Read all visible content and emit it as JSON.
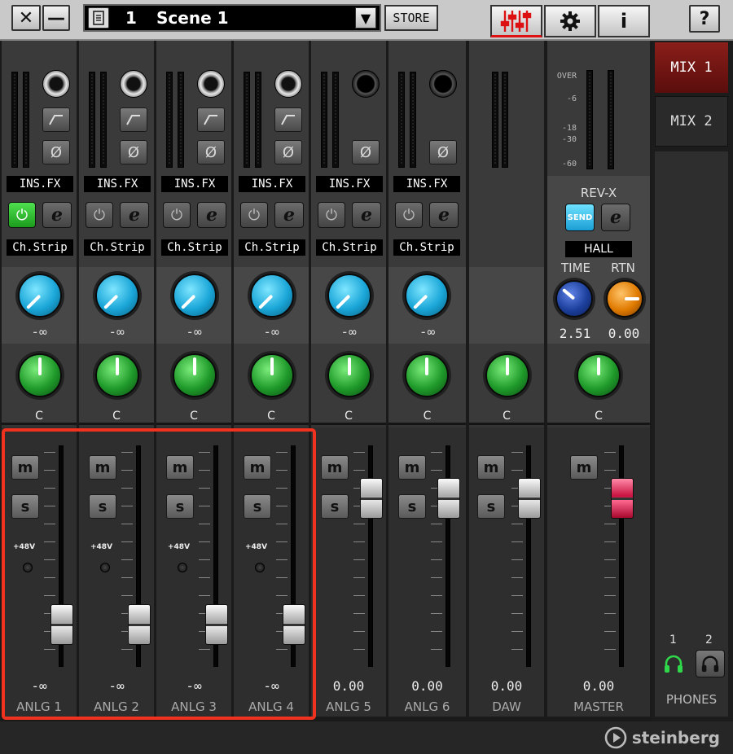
{
  "topbar": {
    "close_label": "✕",
    "minimize_label": "—",
    "scene_number": "1",
    "scene_name": "Scene 1",
    "scene_dropdown": "▼",
    "store_label": "STORE",
    "info_label": "i",
    "help_label": "?"
  },
  "channels": [
    {
      "name": "ANLG 1",
      "ins_fx": "INS.FX",
      "ch_strip": "Ch.Strip",
      "send": "-∞",
      "pan": "C",
      "fader_value": "-∞",
      "phantom": "+48V",
      "jack": "xlr",
      "power_on": true,
      "fader_level": 0.12
    },
    {
      "name": "ANLG 2",
      "ins_fx": "INS.FX",
      "ch_strip": "Ch.Strip",
      "send": "-∞",
      "pan": "C",
      "fader_value": "-∞",
      "phantom": "+48V",
      "jack": "xlr",
      "power_on": false,
      "fader_level": 0.12
    },
    {
      "name": "ANLG 3",
      "ins_fx": "INS.FX",
      "ch_strip": "Ch.Strip",
      "send": "-∞",
      "pan": "C",
      "fader_value": "-∞",
      "phantom": "+48V",
      "jack": "xlr",
      "power_on": false,
      "fader_level": 0.12
    },
    {
      "name": "ANLG 4",
      "ins_fx": "INS.FX",
      "ch_strip": "Ch.Strip",
      "send": "-∞",
      "pan": "C",
      "fader_value": "-∞",
      "phantom": "+48V",
      "jack": "xlr",
      "power_on": false,
      "fader_level": 0.12
    },
    {
      "name": "ANLG 5",
      "ins_fx": "INS.FX",
      "ch_strip": "Ch.Strip",
      "send": "-∞",
      "pan": "C",
      "fader_value": "0.00",
      "phantom": "",
      "jack": "ts",
      "power_on": false,
      "fader_level": 0.82
    },
    {
      "name": "ANLG 6",
      "ins_fx": "INS.FX",
      "ch_strip": "Ch.Strip",
      "send": "-∞",
      "pan": "C",
      "fader_value": "0.00",
      "phantom": "",
      "jack": "ts",
      "power_on": false,
      "fader_level": 0.82
    }
  ],
  "daw": {
    "name": "DAW",
    "pan": "C",
    "fader_value": "0.00",
    "fader_level": 0.82
  },
  "master": {
    "name": "MASTER",
    "pan": "C",
    "fader_value": "0.00",
    "fader_level": 0.82,
    "meter_labels": [
      "OVER",
      "-6",
      "-18",
      "-30",
      "-60"
    ],
    "rev_label": "REV-X",
    "send_label": "SEND",
    "reverb_type": "HALL",
    "time_label": "TIME",
    "rtn_label": "RTN",
    "time_value": "2.51",
    "rtn_value": "0.00"
  },
  "right_panel": {
    "mix1": "MIX 1",
    "mix2": "MIX 2",
    "phones_1": "1",
    "phones_2": "2",
    "phones_label": "PHONES"
  },
  "link_label": "∞",
  "mute_label": "m",
  "solo_label": "s",
  "edit_label": "e",
  "brand": "steinberg",
  "colors": {
    "accent_red": "#f0321e",
    "power_green": "#2ec42e",
    "send_cyan": "#1aa6d8",
    "pan_green": "#1f9a2a"
  }
}
